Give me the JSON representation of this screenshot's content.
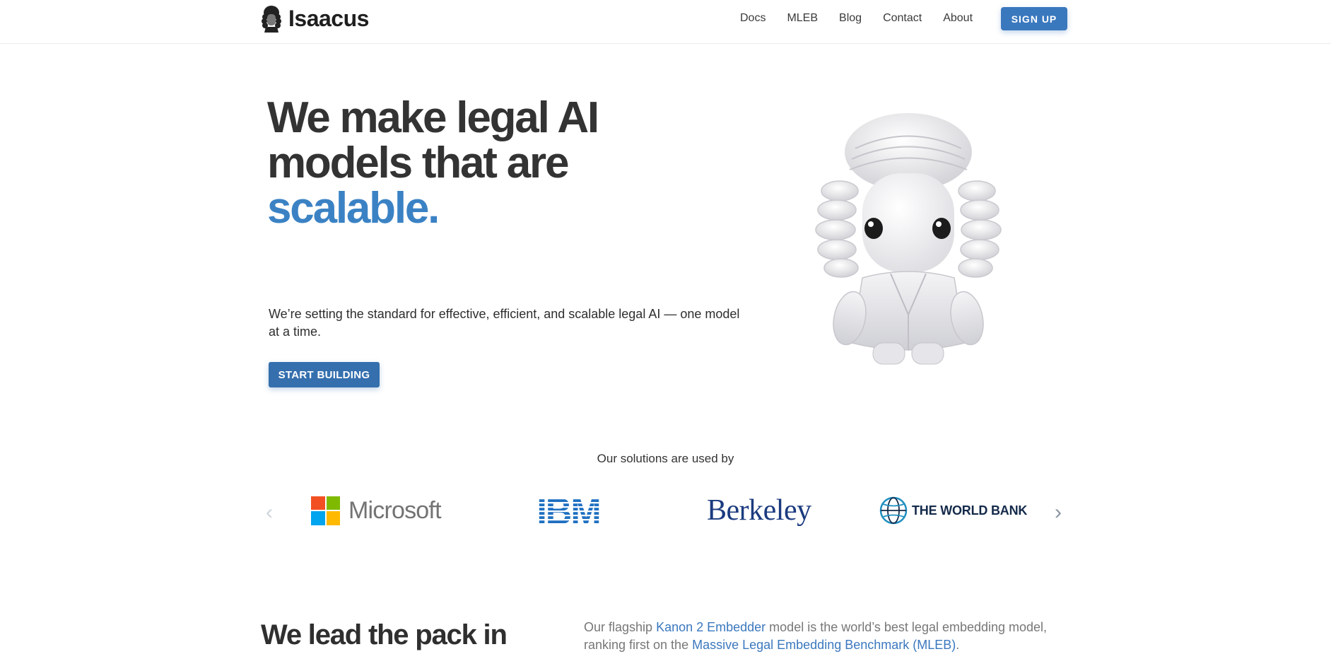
{
  "header": {
    "brand": "Isaacus",
    "nav": [
      "Docs",
      "MLEB",
      "Blog",
      "Contact",
      "About"
    ],
    "signup_label": "SIGN UP"
  },
  "hero": {
    "title_line1": "We make legal AI",
    "title_line2": "models that are",
    "title_accent": "scalable.",
    "subtitle": "We’re setting the standard for effective, efficient, and scalable legal AI — one model at a time.",
    "cta_label": "START BUILDING"
  },
  "clients": {
    "heading": "Our solutions are used by",
    "logos": [
      "Microsoft",
      "IBM",
      "Berkeley",
      "THE WORLD BANK"
    ],
    "prev_arrow": "‹",
    "next_arrow": "›"
  },
  "lead": {
    "title": "We lead the pack in",
    "text_pre": "Our flagship ",
    "link1": "Kanon 2 Embedder",
    "text_mid": " model is the world’s best legal embedding model, ranking first on the ",
    "link2": "Massive Legal Embedding Benchmark (MLEB)",
    "text_post": "."
  },
  "colors": {
    "accent": "#3b82c4",
    "button": "#3a78be",
    "ms_red": "#f25022",
    "ms_green": "#7fba00",
    "ms_blue": "#00a4ef",
    "ms_yellow": "#ffb900",
    "ibm_blue": "#1f70c1",
    "berkeley_blue": "#1b3b7f"
  },
  "icons": {
    "brand": "judge-wig-icon",
    "prev": "chevron-left-icon",
    "next": "chevron-right-icon"
  }
}
